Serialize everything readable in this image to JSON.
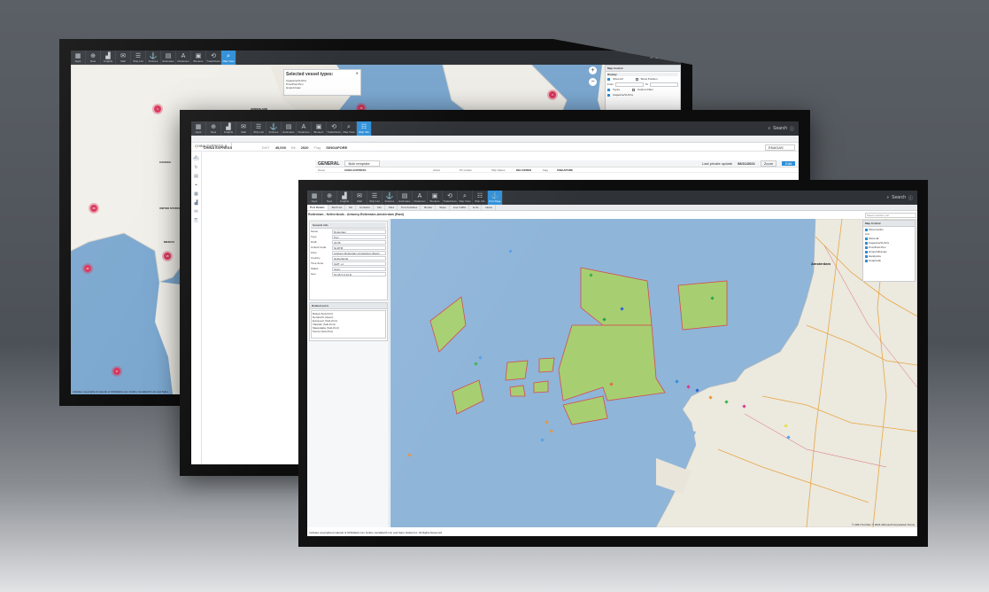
{
  "toolbar": {
    "items": [
      {
        "label": "Apps",
        "icon": "grid-icon"
      },
      {
        "label": "New",
        "icon": "plus-icon"
      },
      {
        "label": "Insights",
        "icon": "chart-icon"
      },
      {
        "label": "Mail",
        "icon": "mail-icon"
      },
      {
        "label": "Ship List",
        "icon": "list-icon"
      },
      {
        "label": "Fixtures",
        "icon": "anchor-icon"
      },
      {
        "label": "Estimates",
        "icon": "calc-icon"
      },
      {
        "label": "Distances",
        "icon": "ruler-icon"
      },
      {
        "label": "Bunkers",
        "icon": "fuel-icon"
      },
      {
        "label": "TradeFlows",
        "icon": "flow-icon"
      },
      {
        "label": "Map View",
        "icon": "map-icon"
      },
      {
        "label": "Ship Info",
        "icon": "ship-icon"
      },
      {
        "label": "Port Page",
        "icon": "port-icon"
      }
    ],
    "search_label": "Search"
  },
  "screen1": {
    "popup_title": "Selected vessel types:",
    "popup_items": [
      "Capesize/VLOCs",
      "Pmx/Post Pmx",
      "Hmax/Umax"
    ],
    "map_labels": {
      "canada": "CANADA",
      "greenland": "GREENLAND",
      "united_states": "UNITED STATES",
      "mexico": "MEXICO"
    },
    "clusters": [
      "1",
      "26",
      "3",
      "26",
      "35",
      "6",
      "21",
      "8"
    ],
    "map_control": {
      "title": "Map Control",
      "display": "Display",
      "show_all": "Show All",
      "show_position": "Show Position",
      "from": "From",
      "to": "To",
      "types": "Types",
      "custom_filter": "Custom Filter",
      "capesize": "Capesize/VLOCs"
    },
    "footer": "Includes copyrighted material of IHSMarkit.com GmbH, AccelEarth Ltd, and Spire"
  },
  "screen2": {
    "tab": "CHINA EXPRESS",
    "vessel_name": "CHINA EXPRESS",
    "dwt_label": "DWT",
    "dwt": "45,000",
    "built_label": "Blt",
    "built": "2020",
    "flag_label": "Flag",
    "flag": "SINGAPORE",
    "search_value": "ENAGAS",
    "general_title": "GENERAL",
    "template": "Bulk template",
    "last_update_label": "Last private update",
    "last_update": "08/11/2021",
    "zoom_btn": "Zoom",
    "edit_btn": "Edit",
    "fields": [
      {
        "k": "Name",
        "v": "CHINA EXPRESS"
      },
      {
        "k": "Active",
        "v": ""
      },
      {
        "k": "Dir marker",
        "v": ""
      },
      {
        "k": "Ship Status",
        "v": "DELIVERED"
      },
      {
        "k": "Flag",
        "v": "SINGAPORE"
      }
    ]
  },
  "screen3": {
    "tabs": [
      "Port Details",
      "Berth list",
      "Ett",
      "Contacts",
      "Info",
      "Files",
      "Port Activities",
      "Border",
      "Ships",
      "Live Traffic",
      "E Ifo",
      "News"
    ],
    "port_search_placeholder": "Select another port",
    "breadcrumb": "Rotterdam - Netherlands - Antwerp-Rotterdam-Amsterdam (Rant)",
    "general_info_title": "General info",
    "general_info": [
      {
        "k": "Name",
        "v": "Rotterdam"
      },
      {
        "k": "Type",
        "v": "Port"
      },
      {
        "k": "Draft",
        "v": "22.55"
      },
      {
        "k": "Unlocd Code",
        "v": "NLRTM"
      },
      {
        "k": "Zone",
        "v": "Antwerp-Rotterdam-Amsterdam (Rant)"
      },
      {
        "k": "Country",
        "v": "Netherlands"
      },
      {
        "k": "Time Zone",
        "v": "GMT +1"
      },
      {
        "k": "Status",
        "v": "Open"
      },
      {
        "k": "Geo",
        "v": "51.95 N 4.12 E"
      }
    ],
    "related_title": "Related ports",
    "related_ports": [
      "Botlek (Sub-Port)",
      "Dordrecht (Open)",
      "Europoort (Sub-Port)",
      "Vlaardin (Sub-Port)",
      "Maasvlakte (Sub-Port)",
      "Pernis (Sub-Port)"
    ],
    "city_label": "Amsterdam",
    "map_control": {
      "title": "Map Control",
      "show_berths": "Show berths",
      "list": "List",
      "show_all": "Show all",
      "types": [
        "Capesize/VLOCs",
        "Pmx/Post Pmx",
        "Hmax/Ultramax",
        "Handysize",
        "Small bulk"
      ]
    },
    "copyright": "© 2021 TomTom © 2021 Microsoft Corporation  Terms",
    "footer": "Includes copyrighted material of IHSMarkit.com GmbH, AccelEarth Ltd, and Spire Global Inc. All Rights Reserved"
  },
  "colors": {
    "toolbar": "#2f3338",
    "accent": "#2f8fd8",
    "sea": "#7ba7cf",
    "zone_fill": "#a7cf72",
    "zone_border": "#d84b4b",
    "cluster": "#d9355a"
  }
}
